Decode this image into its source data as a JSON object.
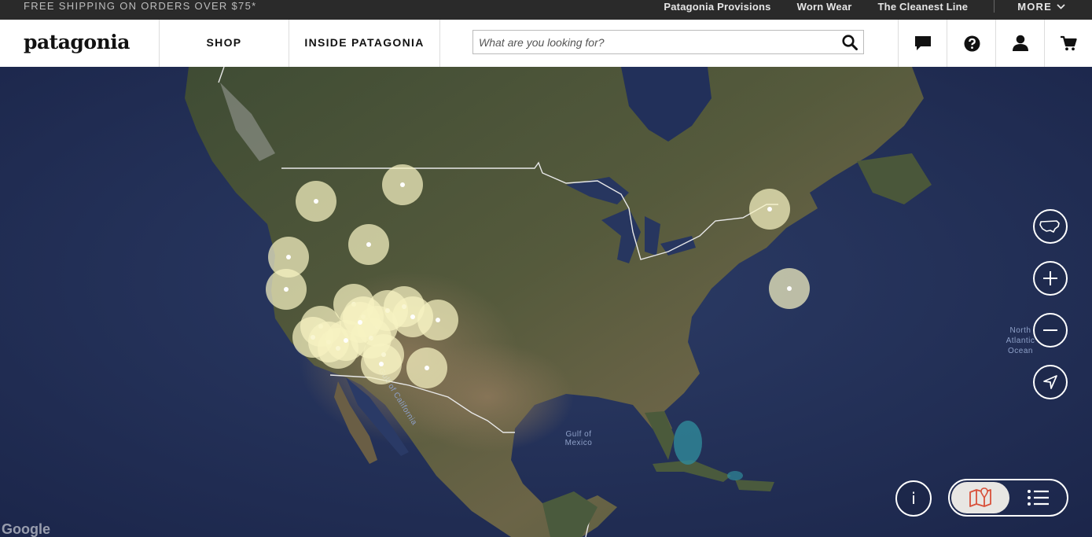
{
  "promo": {
    "shipping": "FREE SHIPPING ON ORDERS OVER $75*",
    "links": [
      "Patagonia Provisions",
      "Worn Wear",
      "The Cleanest Line"
    ],
    "more": "MORE"
  },
  "header": {
    "logo": "patagonia",
    "nav": [
      "SHOP",
      "INSIDE PATAGONIA"
    ],
    "search_placeholder": "What are you looking for?",
    "icons": [
      "chat-icon",
      "help-icon",
      "account-icon",
      "cart-icon"
    ]
  },
  "map": {
    "labels": {
      "gulf_of_california": "Gulf of California",
      "gulf_of_mexico_1": "Gulf of",
      "gulf_of_mexico_2": "Mexico",
      "atlantic_1": "North",
      "atlantic_2": "Atlantic",
      "atlantic_3": "Ocean"
    },
    "attribution": "Google",
    "controls": [
      "usa-view-icon",
      "zoom-in-icon",
      "zoom-out-icon",
      "locate-icon"
    ],
    "info_label": "i",
    "view_toggle": {
      "active": "map",
      "options": [
        "map-view-icon",
        "list-view-icon"
      ]
    },
    "marker_color": "#f6f3c2",
    "marker_count": 24
  }
}
